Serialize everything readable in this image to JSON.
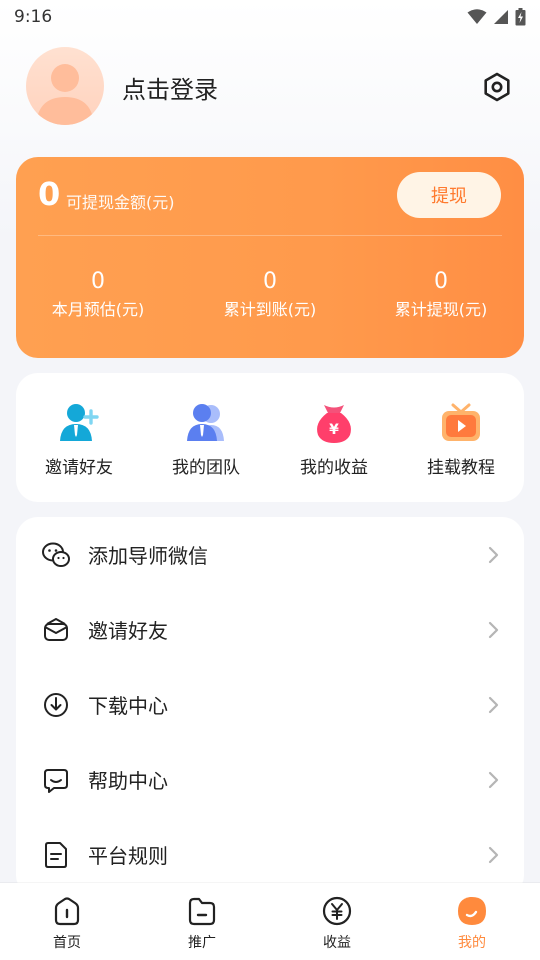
{
  "status_bar": {
    "time": "9:16"
  },
  "profile": {
    "login_text": "点击登录"
  },
  "earnings": {
    "main_value": "0",
    "main_label": "可提现金额(元)",
    "withdraw_label": "提现",
    "stats": [
      {
        "value": "0",
        "label": "本月预估(元)"
      },
      {
        "value": "0",
        "label": "累计到账(元)"
      },
      {
        "value": "0",
        "label": "累计提现(元)"
      }
    ]
  },
  "shortcuts": [
    {
      "label": "邀请好友",
      "icon": "invite-friend-icon"
    },
    {
      "label": "我的团队",
      "icon": "team-icon"
    },
    {
      "label": "我的收益",
      "icon": "money-bag-icon"
    },
    {
      "label": "挂载教程",
      "icon": "tv-tutorial-icon"
    }
  ],
  "menu": [
    {
      "label": "添加导师微信",
      "icon": "wechat-icon"
    },
    {
      "label": "邀请好友",
      "icon": "envelope-icon"
    },
    {
      "label": "下载中心",
      "icon": "download-icon"
    },
    {
      "label": "帮助中心",
      "icon": "chat-help-icon"
    },
    {
      "label": "平台规则",
      "icon": "document-icon"
    }
  ],
  "tabs": [
    {
      "label": "首页",
      "icon": "home-icon",
      "active": false
    },
    {
      "label": "推广",
      "icon": "folder-icon",
      "active": false
    },
    {
      "label": "收益",
      "icon": "yen-icon",
      "active": false
    },
    {
      "label": "我的",
      "icon": "profile-icon",
      "active": true
    }
  ],
  "colors": {
    "accent": "#ff8a3d",
    "card_gradient_start": "#ffa051",
    "card_gradient_end": "#ff8e44",
    "withdraw_bg": "#fff4e6",
    "page_bg": "#f4f5f9"
  }
}
